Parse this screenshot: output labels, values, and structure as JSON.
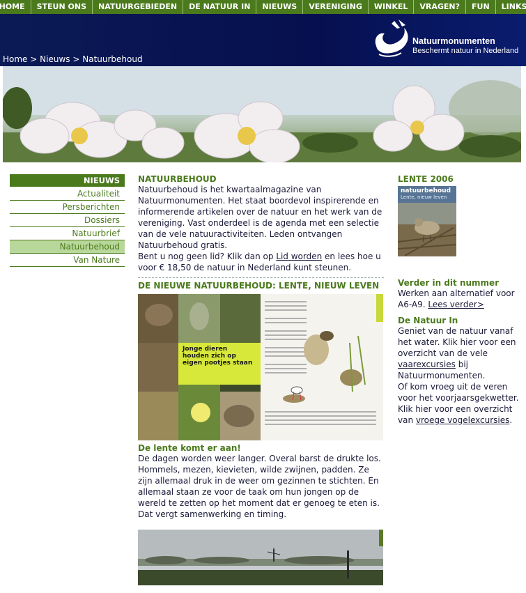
{
  "topnav": {
    "items": [
      "HOME",
      "STEUN ONS",
      "NATUURGEBIEDEN",
      "DE NATUUR IN",
      "NIEUWS",
      "VERENIGING",
      "WINKEL",
      "VRAGEN?",
      "FUN",
      "LINKS"
    ]
  },
  "breadcrumb": {
    "home": "Home",
    "sep": ">",
    "nieuws": "Nieuws",
    "current": "Natuurbehoud"
  },
  "logo": {
    "name": "Natuurmonumenten",
    "tagline": "Beschermt natuur in Nederland"
  },
  "leftnav": {
    "heading": "NIEUWS",
    "items": [
      "Actualiteit",
      "Persberichten",
      "Dossiers",
      "Natuurbrief",
      "Natuurbehoud",
      "Van Nature"
    ],
    "active": "Natuurbehoud"
  },
  "main": {
    "title": "NATUURBEHOUD",
    "intro": "Natuurbehoud is het kwartaalmagazine van Natuurmonumenten. Het staat boordevol inspirerende en informerende artikelen over de natuur en het werk van de vereniging. Vast onderdeel is de agenda met een selectie van de vele natuuractiviteiten. Leden ontvangen Natuurbehoud gratis.",
    "member_before": "Bent u nog geen lid? Klik dan op ",
    "member_link": "Lid worden",
    "member_after": " en lees hoe u voor € 18,50 de natuur in Nederland kunt steunen.",
    "section_title": "DE NIEUWE NATUURBEHOUD: LENTE, NIEUW LEVEN",
    "spread_caption": "Jonge dieren houden zich op eigen pootjes staan",
    "article_heading": "De lente komt er aan!",
    "article_body": "De dagen worden weer langer. Overal barst de drukte los. Hommels, mezen, kievieten, wilde zwijnen, padden. Ze zijn allemaal druk in de weer om gezinnen te stichten. En allemaal staan ze voor de taak om hun jongen op de wereld te zetten op het moment dat er genoeg te eten is. Dat vergt samenwerking en timing."
  },
  "right": {
    "issue_title": "LENTE 2006",
    "cover_brand": "natuurbehoud",
    "cover_sub": "Lente, nieuw leven",
    "more_heading": "Verder in dit nummer",
    "more_text": "Werken aan alternatief voor A6-A9. ",
    "more_link": "Lees verder>",
    "natuur_heading": "De Natuur In",
    "natuur_text1": "Geniet van de natuur vanaf het water. Klik hier voor een overzicht van de vele ",
    "natuur_link1": "vaarexcursies",
    "natuur_text2": " bij Natuurmonumenten.",
    "natuur_text3": "Of kom vroeg uit de veren voor het voorjaarsgekwetter. Klik hier voor een overzicht van ",
    "natuur_link2": "vroege vogelexcursies",
    "natuur_text4": "."
  },
  "colors": {
    "green": "#4a7a1c",
    "navy": "#061050",
    "active_bg": "#b8d79a"
  }
}
